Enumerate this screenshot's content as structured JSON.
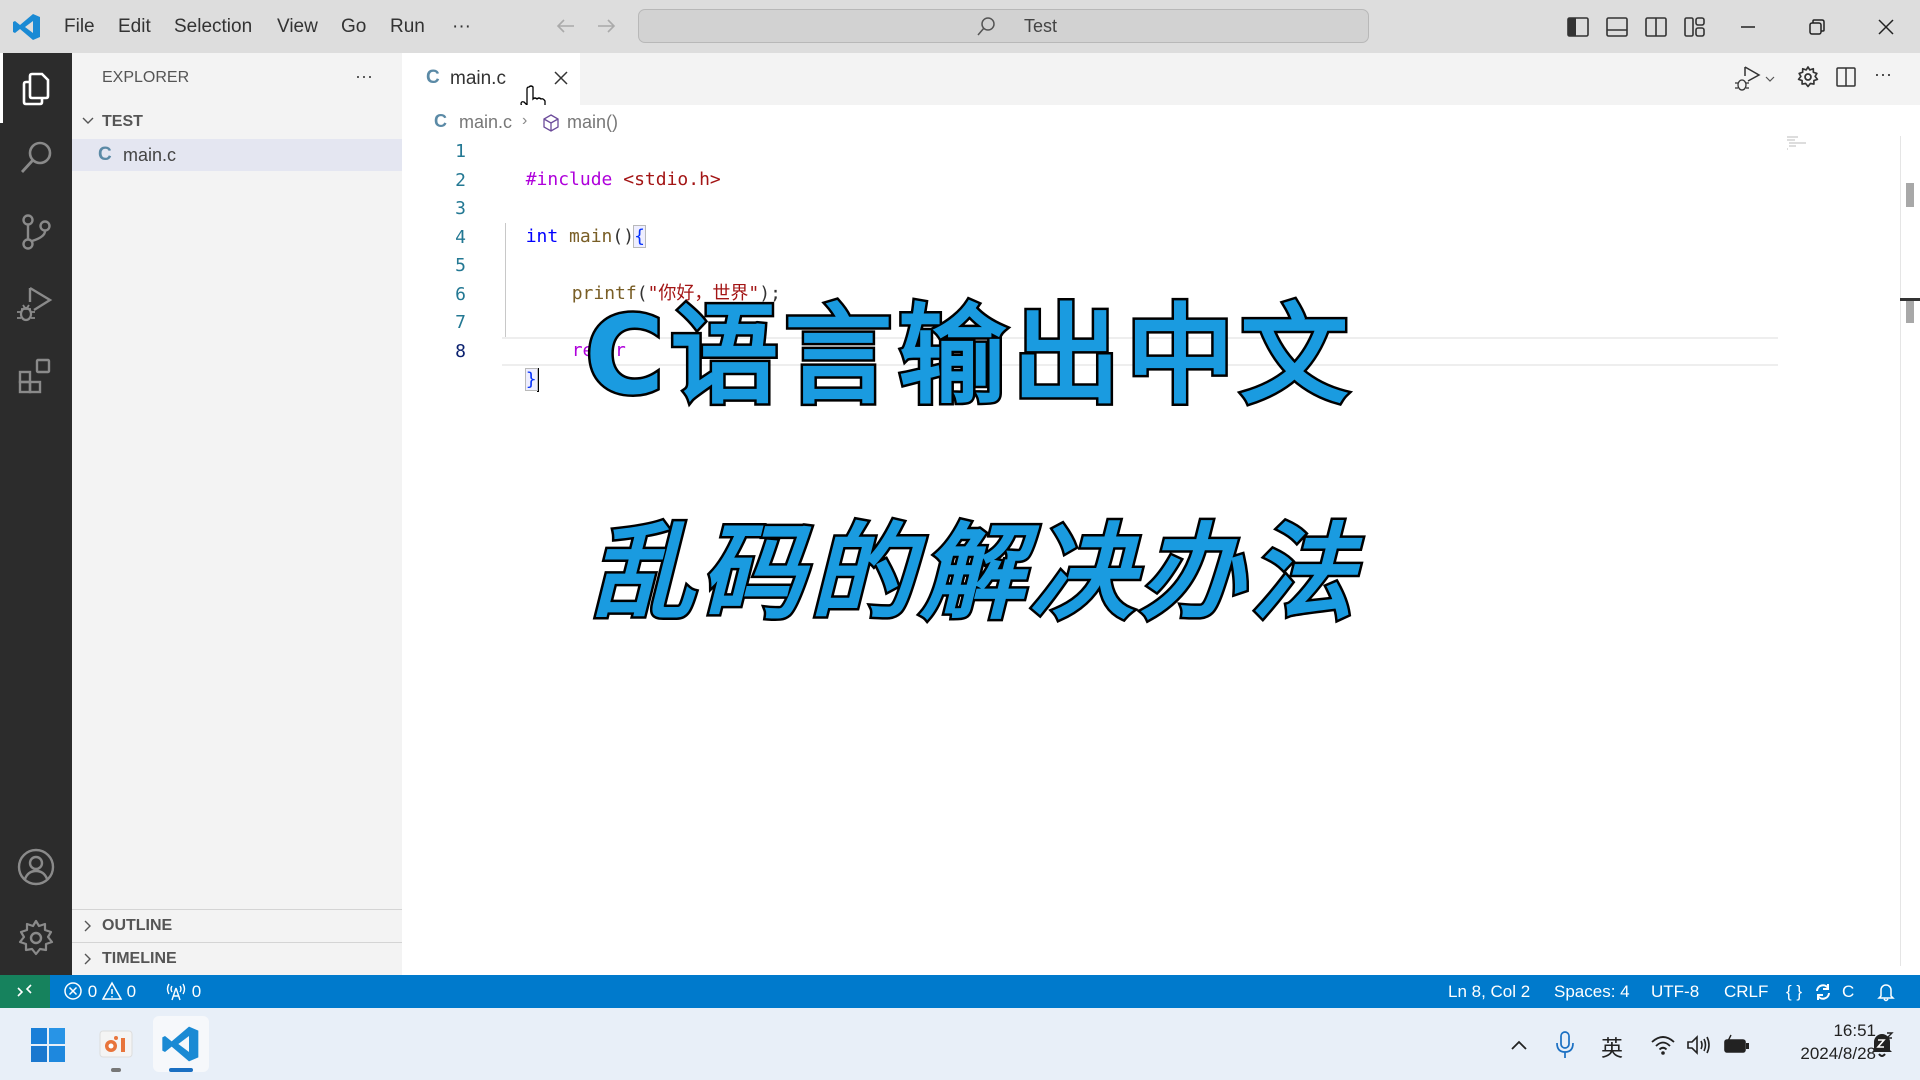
{
  "titlebar": {
    "menu": [
      "File",
      "Edit",
      "Selection",
      "View",
      "Go",
      "Run"
    ],
    "more_label": "···",
    "search_text": "Test",
    "icons": [
      "toggle-primary-sidebar-icon",
      "toggle-panel-icon",
      "toggle-secondary-sidebar-icon",
      "customize-layout-icon"
    ],
    "window_controls": [
      "minimize-icon",
      "restore-icon",
      "close-icon"
    ]
  },
  "activitybar": {
    "items": [
      "explorer",
      "search",
      "source-control",
      "run-and-debug",
      "extensions"
    ],
    "bottom": [
      "accounts",
      "manage"
    ]
  },
  "sidebar": {
    "title": "EXPLORER",
    "more_label": "···",
    "folder": "TEST",
    "files": [
      {
        "icon": "C",
        "name": "main.c"
      }
    ],
    "sections": [
      "OUTLINE",
      "TIMELINE"
    ]
  },
  "editor": {
    "tab": {
      "icon": "C",
      "label": "main.c"
    },
    "breadcrumb": {
      "icon": "C",
      "file": "main.c",
      "symbol": "main()"
    },
    "lines": [
      {
        "no": "1"
      },
      {
        "no": "2"
      },
      {
        "no": "3"
      },
      {
        "no": "4"
      },
      {
        "no": "5"
      },
      {
        "no": "6"
      },
      {
        "no": "7"
      },
      {
        "no": "8"
      }
    ],
    "code": {
      "l1_directive": "#include",
      "l1_header": "<stdio.h>",
      "l3_type": "int",
      "l3_fn": "main",
      "l3_parens": "()",
      "l3_brace": "{",
      "l5_fn": "printf",
      "l5_open": "(",
      "l5_str": "\"你好，世界\"",
      "l5_close": ");",
      "l7_kw": "retur",
      "l8_brace": "}"
    }
  },
  "overlay": {
    "line1": "C语言输出中文",
    "line2": "乱码的解决办法"
  },
  "statusbar": {
    "errors": "0",
    "warnings": "0",
    "ports": "0",
    "position": "Ln 8, Col 2",
    "indent": "Spaces: 4",
    "encoding": "UTF-8",
    "eol": "CRLF",
    "language": "C",
    "language_mode_icon": "{ }"
  },
  "taskbar": {
    "apps": [
      "start",
      "presentation-app",
      "vscode"
    ],
    "ime": "英",
    "time": "16:51",
    "date": "2024/8/28"
  },
  "colors": {
    "accent": "#007acc",
    "remote": "#16825d",
    "overlay_fill": "#1a9be0"
  }
}
